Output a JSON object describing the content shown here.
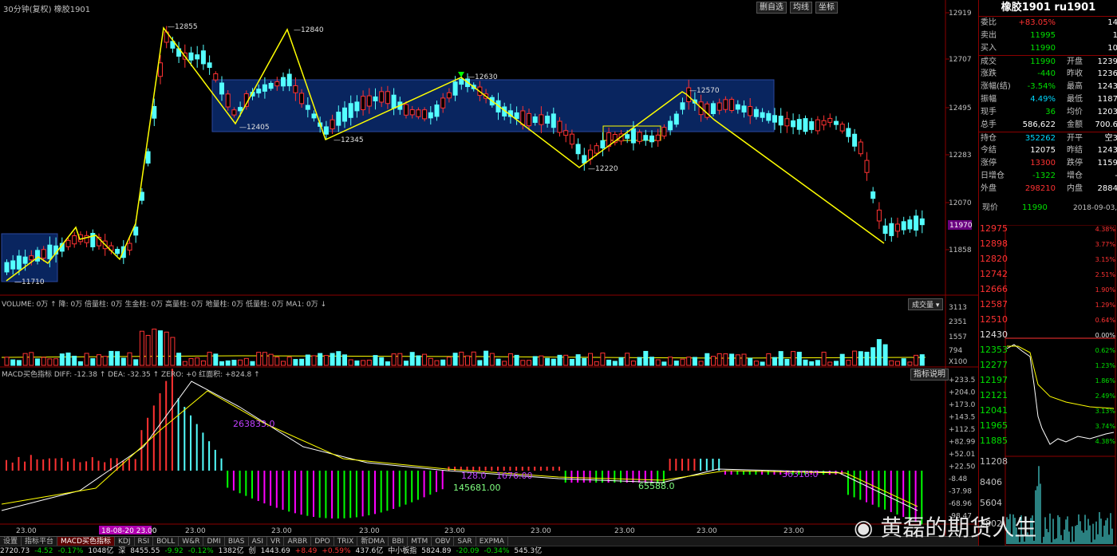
{
  "header": {
    "title": "30分钟(复权)  橡胶1901"
  },
  "toolbar": [
    "删自选",
    "均线",
    "坐标"
  ],
  "price_axis": {
    "labels": [
      "12919",
      "12707",
      "12495",
      "12283",
      "12070",
      "11858"
    ],
    "current": "11970"
  },
  "annotations": {
    "p1": "12855",
    "p2": "12840",
    "p3": "12405",
    "p4": "12345",
    "p5": "12630",
    "p6": "12220",
    "p7": "12570",
    "p8": "11710"
  },
  "volume": {
    "legend": "VOLUME: 0万 ↑  降: 0万  倍量柱: 0万  生金柱: 0万  高量柱: 0万  地量柱: 0万  低量柱: 0万  MA1: 0万 ↓",
    "dropdown": "成交量",
    "axis": [
      "3113",
      "2351",
      "1557",
      "794",
      "X100"
    ]
  },
  "macd": {
    "legend": "MACD买色指标  DIFF: -12.38 ↑  DEA: -32.35 ↑  ZERO: +0  红面积: +824.8 ↑",
    "help": "指标说明",
    "axis": [
      "+233.5",
      "+204.0",
      "+173.0",
      "+143.5",
      "+112.5",
      "+82.99",
      "+52.01",
      "+22.50",
      "-8.48",
      "-37.98",
      "-68.96",
      "-98.47"
    ],
    "labels": {
      "a": "263833.0",
      "b": "128.0",
      "c": "145681.00",
      "d": "1676.00",
      "e": "65588.0",
      "f": "36318.0"
    }
  },
  "time_axis": {
    "labels": [
      "23.00",
      "18-08-20 23.00",
      "23.00",
      "23.00",
      "23.00",
      "23.00",
      "23.00",
      "23.00",
      "23.00",
      "23.00"
    ]
  },
  "tabs": [
    "设置",
    "指标平台",
    "MACD买色指标",
    "KDJ",
    "RSI",
    "BOLL",
    "W&R",
    "DMI",
    "BIAS",
    "ASI",
    "VR",
    "ARBR",
    "DPO",
    "TRIX",
    "新DMA",
    "BBI",
    "MTM",
    "OBV",
    "SAR",
    "EXPMA"
  ],
  "quote": {
    "title": "橡胶1901 ru1901",
    "rows": [
      {
        "l": "委比",
        "v": "+83.05%",
        "vc": "red",
        "l2": "",
        "v2": "14"
      },
      {
        "l": "卖出",
        "v": "11995",
        "vc": "green",
        "l2": "",
        "v2": "1"
      },
      {
        "l": "买入",
        "v": "11990",
        "vc": "green",
        "l2": "",
        "v2": "10"
      },
      {
        "l": "成交",
        "v": "11990",
        "vc": "green",
        "l2": "开盘",
        "v2": "1239"
      },
      {
        "l": "涨跌",
        "v": "-440",
        "vc": "green",
        "l2": "昨收",
        "v2": "1236"
      },
      {
        "l": "涨幅(结)",
        "v": "-3.54%",
        "vc": "green",
        "l2": "最高",
        "v2": "1243"
      },
      {
        "l": "振幅",
        "v": "4.49%",
        "vc": "cyan",
        "l2": "最低",
        "v2": "1187"
      },
      {
        "l": "现手",
        "v": "36",
        "vc": "green",
        "l2": "均价",
        "v2": "1203"
      },
      {
        "l": "总手",
        "v": "586,622",
        "vc": "white",
        "l2": "金额",
        "v2": "700.6"
      },
      {
        "l": "持仓",
        "v": "352262",
        "vc": "cyan",
        "l2": "开平",
        "v2": "空3"
      },
      {
        "l": "今结",
        "v": "12075",
        "vc": "white",
        "l2": "昨结",
        "v2": "1243"
      },
      {
        "l": "涨停",
        "v": "13300",
        "vc": "red",
        "l2": "跌停",
        "v2": "1159"
      },
      {
        "l": "日增仓",
        "v": "-1322",
        "vc": "green",
        "l2": "增仓",
        "v2": "-"
      },
      {
        "l": "外盘",
        "v": "298210",
        "vc": "red",
        "l2": "内盘",
        "v2": "2884"
      }
    ],
    "last": {
      "label": "现价",
      "value": "11990",
      "time": "2018-09-03,"
    }
  },
  "mini": {
    "left": [
      "12975",
      "12898",
      "12820",
      "12742",
      "12666",
      "12587",
      "12510",
      "12430",
      "12353",
      "12277",
      "12197",
      "12121",
      "12041",
      "11965",
      "11885",
      "11208",
      "8406",
      "5604",
      "2802"
    ],
    "right": [
      "4.38%",
      "3.77%",
      "3.15%",
      "2.51%",
      "1.90%",
      "1.29%",
      "0.64%",
      "0.00%",
      "0.62%",
      "1.23%",
      "1.86%",
      "2.49%",
      "3.13%",
      "3.74%",
      "4.38%"
    ]
  },
  "status": [
    {
      "t": "2720.73",
      "c": "white"
    },
    {
      "t": "-4.52",
      "c": "green"
    },
    {
      "t": "-0.17%",
      "c": "green"
    },
    {
      "t": "1048亿",
      "c": "white"
    },
    {
      "t": "深",
      "c": "white"
    },
    {
      "t": "8455.55",
      "c": "white"
    },
    {
      "t": "-9.92",
      "c": "green"
    },
    {
      "t": "-0.12%",
      "c": "green"
    },
    {
      "t": "1382亿",
      "c": "white"
    },
    {
      "t": "创",
      "c": "white"
    },
    {
      "t": "1443.69",
      "c": "white"
    },
    {
      "t": "+8.49",
      "c": "red"
    },
    {
      "t": "+0.59%",
      "c": "red"
    },
    {
      "t": "437.6亿",
      "c": "white"
    },
    {
      "t": "中小板指",
      "c": "white"
    },
    {
      "t": "5824.89",
      "c": "white"
    },
    {
      "t": "-20.09",
      "c": "green"
    },
    {
      "t": "-0.34%",
      "c": "green"
    },
    {
      "t": "545.3亿",
      "c": "white"
    }
  ],
  "watermark": "黄磊的期货人生",
  "colors": {
    "up": "#ff3232",
    "down": "#54ffff",
    "zone": "#0a2a6a",
    "trend": "#ffff00",
    "bg": "#000000",
    "grid": "#8b0000"
  }
}
